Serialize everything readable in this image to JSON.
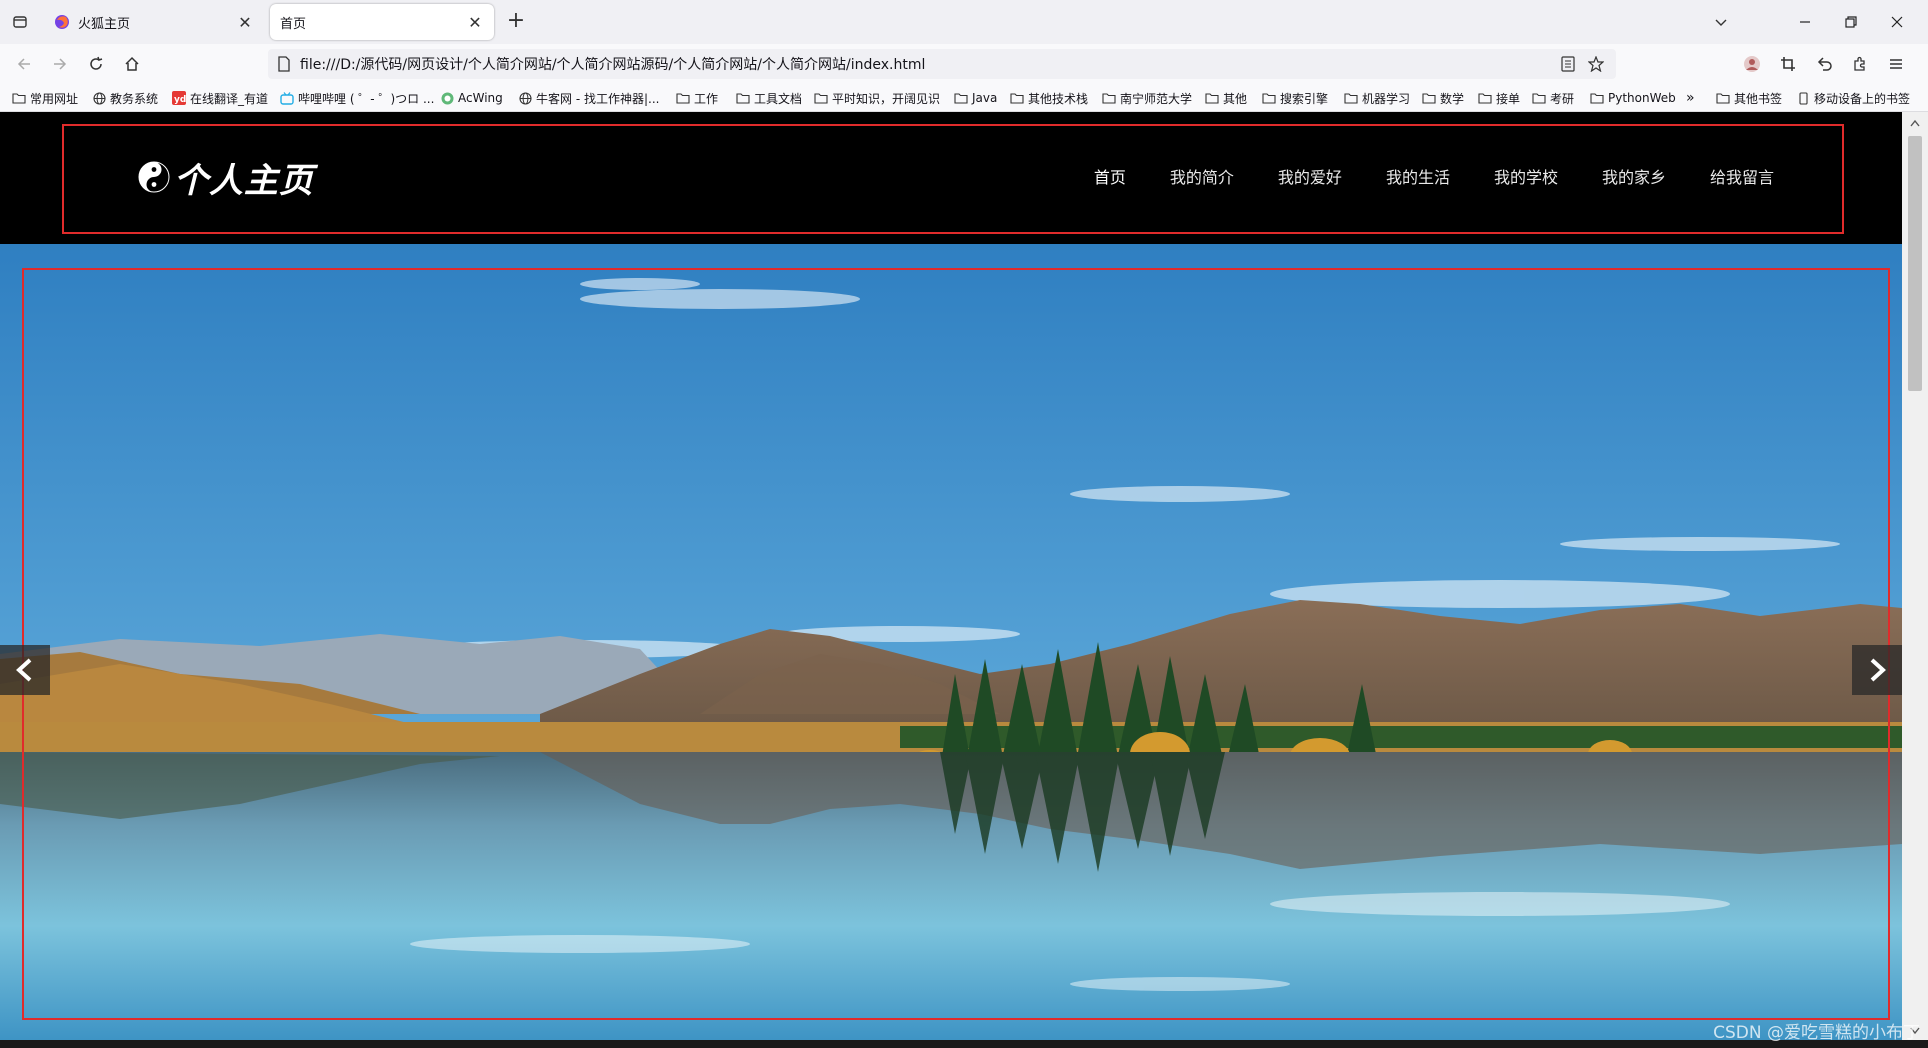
{
  "browser": {
    "tabs": [
      {
        "title": "火狐主页"
      },
      {
        "title": "首页"
      }
    ],
    "address": "file:///D:/源代码/网页设计/个人简介网站/个人简介网站源码/个人简介网站/个人简介网站/index.html",
    "bookmarks": [
      {
        "label": "常用网址",
        "icon": "folder-icon"
      },
      {
        "label": "教务系统",
        "icon": "globe-icon"
      },
      {
        "label": "在线翻译_有道",
        "icon": "youdao-icon"
      },
      {
        "label": "哔哩哔哩 ( ゜- ゜)つロ ...",
        "icon": "bilibili-icon"
      },
      {
        "label": "AcWing",
        "icon": "acwing-icon"
      },
      {
        "label": "牛客网 - 找工作神器|...",
        "icon": "globe-icon"
      },
      {
        "label": "工作",
        "icon": "folder-icon"
      },
      {
        "label": "工具文档",
        "icon": "folder-icon"
      },
      {
        "label": "平时知识，开阔见识",
        "icon": "folder-icon"
      },
      {
        "label": "Java",
        "icon": "folder-icon"
      },
      {
        "label": "其他技术栈",
        "icon": "folder-icon"
      },
      {
        "label": "南宁师范大学",
        "icon": "folder-icon"
      },
      {
        "label": "其他",
        "icon": "folder-icon"
      },
      {
        "label": "搜索引擎",
        "icon": "folder-icon"
      },
      {
        "label": "机器学习",
        "icon": "folder-icon"
      },
      {
        "label": "数学",
        "icon": "folder-icon"
      },
      {
        "label": "接单",
        "icon": "folder-icon"
      },
      {
        "label": "考研",
        "icon": "folder-icon"
      },
      {
        "label": "PythonWeb",
        "icon": "folder-icon"
      }
    ],
    "overflow_label": "»",
    "other_bookmarks": "其他书签",
    "mobile_bookmarks": "移动设备上的书签"
  },
  "site": {
    "logo_text": "个人主页",
    "nav": [
      "首页",
      "我的简介",
      "我的爱好",
      "我的生活",
      "我的学校",
      "我的家乡",
      "给我留言"
    ],
    "active_nav": 0
  },
  "watermark": "CSDN @爱吃雪糕的小布丁",
  "colors": {
    "header_bg": "#000000",
    "outline": "#e02b2b",
    "sky_top": "#3a8cc8",
    "lake": "#5ab4d4"
  }
}
